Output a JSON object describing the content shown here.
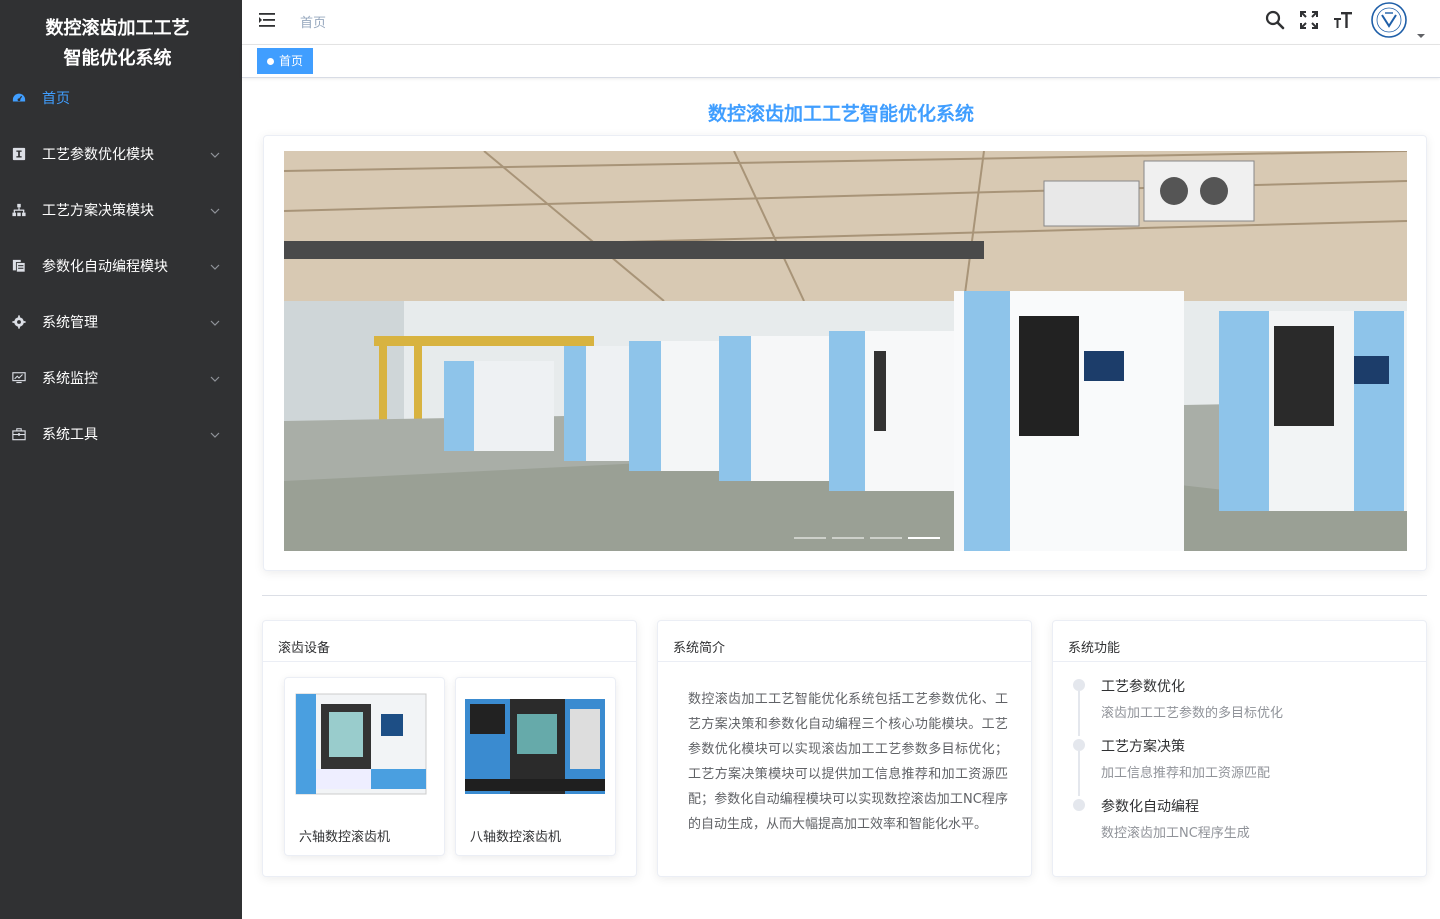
{
  "sidebar": {
    "brand_line1": "数控滚齿加工工艺",
    "brand_line2": "智能优化系统",
    "items": [
      {
        "label": "首页",
        "icon": "dashboard-icon",
        "active": true
      },
      {
        "label": "工艺参数优化模块",
        "icon": "param-icon"
      },
      {
        "label": "工艺方案决策模块",
        "icon": "tree-icon"
      },
      {
        "label": "参数化自动编程模块",
        "icon": "code-file-icon"
      },
      {
        "label": "系统管理",
        "icon": "gear-icon"
      },
      {
        "label": "系统监控",
        "icon": "monitor-icon"
      },
      {
        "label": "系统工具",
        "icon": "toolbox-icon"
      }
    ]
  },
  "header": {
    "breadcrumb": "首页",
    "tools": [
      "search-icon",
      "fullscreen-icon",
      "font-size-icon",
      "avatar",
      "caret-down-icon"
    ]
  },
  "tags": {
    "active_tag": "首页"
  },
  "main": {
    "title": "数控滚齿加工工艺智能优化系统",
    "carousel": {
      "slides": 4,
      "active_index": 3
    },
    "equipment": {
      "header": "滚齿设备",
      "items": [
        {
          "caption": "六轴数控滚齿机"
        },
        {
          "caption": "八轴数控滚齿机"
        }
      ]
    },
    "intro": {
      "header": "系统简介",
      "text": "数控滚齿加工工艺智能优化系统包括工艺参数优化、工艺方案决策和参数化自动编程三个核心功能模块。工艺参数优化模块可以实现滚齿加工工艺参数多目标优化；工艺方案决策模块可以提供加工信息推荐和加工资源匹配；参数化自动编程模块可以实现数控滚齿加工NC程序的自动生成，从而大幅提高加工效率和智能化水平。"
    },
    "features": {
      "header": "系统功能",
      "items": [
        {
          "title": "工艺参数优化",
          "desc": "滚齿加工工艺参数的多目标优化"
        },
        {
          "title": "工艺方案决策",
          "desc": "加工信息推荐和加工资源匹配"
        },
        {
          "title": "参数化自动编程",
          "desc": "数控滚齿加工NC程序生成"
        }
      ]
    }
  },
  "colors": {
    "sidebar_bg": "#303133",
    "accent": "#409eff",
    "machine_blue": "#8ec4ea"
  }
}
